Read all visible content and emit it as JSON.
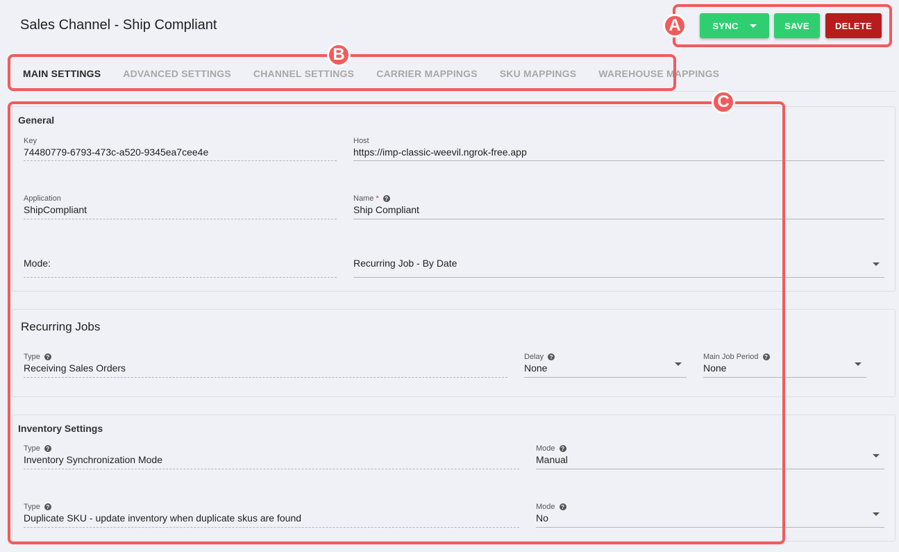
{
  "header": {
    "title": "Sales Channel - Ship Compliant",
    "sync_label": "SYNC",
    "save_label": "SAVE",
    "delete_label": "DELETE"
  },
  "tabs": [
    {
      "label": "MAIN SETTINGS"
    },
    {
      "label": "ADVANCED SETTINGS"
    },
    {
      "label": "CHANNEL SETTINGS"
    },
    {
      "label": "CARRIER MAPPINGS"
    },
    {
      "label": "SKU MAPPINGS"
    },
    {
      "label": "WAREHOUSE MAPPINGS"
    }
  ],
  "general": {
    "title": "General",
    "key_label": "Key",
    "key_value": "74480779-6793-473c-a520-9345ea7cee4e",
    "host_label": "Host",
    "host_value": "https://imp-classic-weevil.ngrok-free.app",
    "application_label": "Application",
    "application_value": "ShipCompliant",
    "name_label": "Name",
    "name_required": "*",
    "name_value": "Ship Compliant",
    "mode_label": "Mode:",
    "mode_value": "Recurring Job - By Date"
  },
  "recurring": {
    "title": "Recurring Jobs",
    "type_label": "Type",
    "type_value": "Receiving Sales Orders",
    "delay_label": "Delay",
    "delay_value": "None",
    "period_label": "Main Job Period",
    "period_value": "None"
  },
  "inventory": {
    "title": "Inventory Settings",
    "rows": [
      {
        "type_label": "Type",
        "type_value": "Inventory Synchronization Mode",
        "mode_label": "Mode",
        "mode_value": "Manual"
      },
      {
        "type_label": "Type",
        "type_value": "Duplicate SKU - update inventory when duplicate skus are found",
        "mode_label": "Mode",
        "mode_value": "No"
      }
    ]
  },
  "annotations": {
    "a": "A",
    "b": "B",
    "c": "C"
  },
  "help_glyph": "?",
  "colors": {
    "accent_green": "#2fcf71",
    "danger_red": "#b91c1c",
    "annotation_red": "#f25b5b",
    "background": "#eff1f6"
  }
}
